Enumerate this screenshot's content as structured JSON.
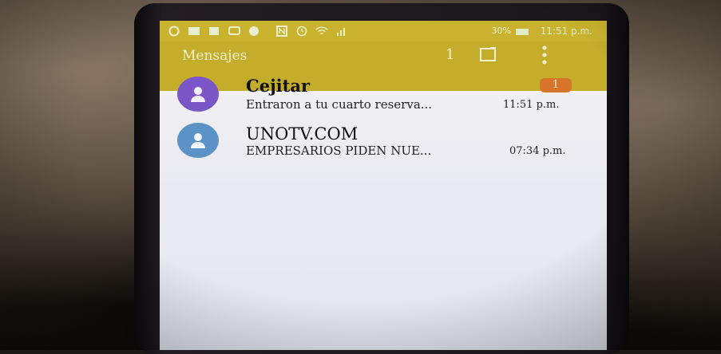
{
  "status_bar": {
    "battery_percent": "30%",
    "time": "11:51 p.m.",
    "icons": [
      "whatsapp-icon",
      "message-icon",
      "gallery-icon",
      "chat-icon",
      "app-icon",
      "nfc-icon",
      "alarm-icon",
      "wifi-icon",
      "signal-icon",
      "battery-icon"
    ]
  },
  "app_bar": {
    "title": "Mensajes",
    "unread_count": "1",
    "compose_icon": "compose-icon",
    "overflow_icon": "overflow-menu-icon"
  },
  "conversations": [
    {
      "name": "Cejitar",
      "snippet": "Entraron a tu cuarto reserva...",
      "time": "11:51 p.m.",
      "badge": "1",
      "avatar_color": "#7a56c6"
    },
    {
      "name": "UNOTV.COM",
      "snippet": "EMPRESARIOS PIDEN NUE...",
      "time": "07:34 p.m.",
      "badge": "",
      "avatar_color": "#5b93c8"
    }
  ],
  "colors": {
    "app_bar": "#c4ad2b",
    "badge": "#d8732a"
  }
}
